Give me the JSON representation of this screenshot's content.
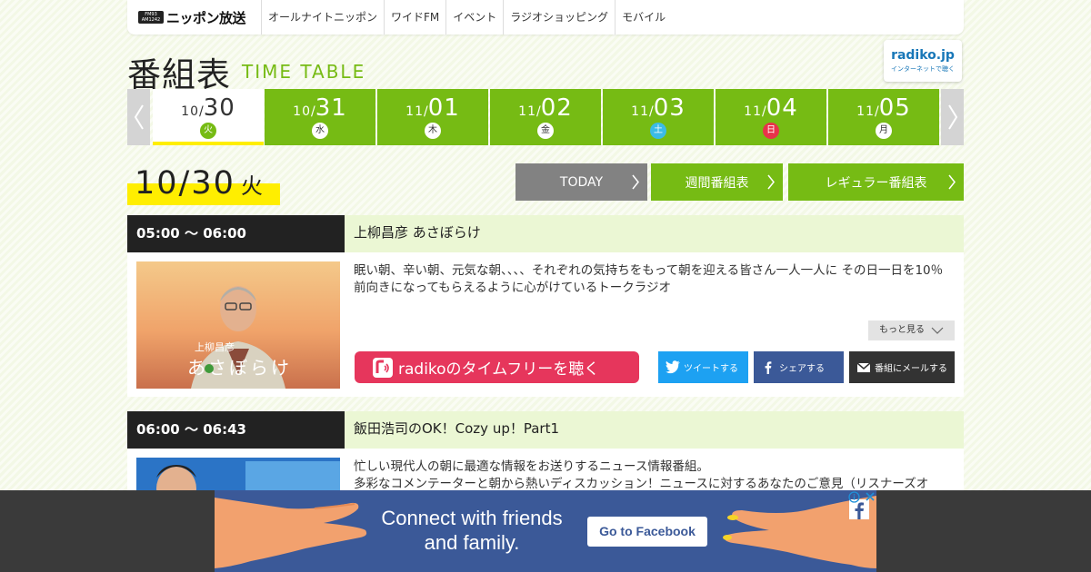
{
  "nav": {
    "logo_badge_top": "FM93",
    "logo_badge_bottom": "AM1242",
    "logo_text": "ニッポン放送",
    "items": [
      "オールナイトニッポン",
      "ワイドFM",
      "イベント",
      "ラジオショッピング",
      "モバイル"
    ]
  },
  "title": {
    "jp": "番組表",
    "en": "TIME TABLE"
  },
  "radiko": {
    "line1": "radiko.jp",
    "line2": "インターネットで聴く"
  },
  "dates": [
    {
      "month": "10",
      "day": "30",
      "dow": "火",
      "active": true
    },
    {
      "month": "10",
      "day": "31",
      "dow": "水"
    },
    {
      "month": "11",
      "day": "01",
      "dow": "木"
    },
    {
      "month": "11",
      "day": "02",
      "dow": "金"
    },
    {
      "month": "11",
      "day": "03",
      "dow": "土"
    },
    {
      "month": "11",
      "day": "04",
      "dow": "日"
    },
    {
      "month": "11",
      "day": "05",
      "dow": "月"
    }
  ],
  "current": {
    "date": "10/30",
    "dow": "火"
  },
  "buttons": {
    "today": "TODAY",
    "weekly": "週間番組表",
    "regular": "レギュラー番組表"
  },
  "programs": [
    {
      "time": "05:00 ～ 06:00",
      "title": "上柳昌彦 あさぼらけ",
      "desc": "眠い朝、辛い朝、元気な朝、、、、それぞれの気持ちをもって朝を迎える皆さん一人一人に その日一日を10％前向きになってもらえるように心がけているトークラジオ",
      "img_caption_small": "上柳昌彦",
      "img_caption_large": "あさぼらけ",
      "more": "もっと見る",
      "radiko": "radikoのタイムフリーを聴く",
      "tweet": "ツイートする",
      "share": "シェアする",
      "mail": "番組にメールする"
    },
    {
      "time": "06:00 ～ 06:43",
      "title": "飯田浩司のOK！Cozy up！Part1",
      "desc_lines": [
        "忙しい現代人の朝に最適な情報をお送りするニュース情報番組。",
        "多彩なコメンテーターと朝から熱いディスカッション！ニュースに対するあなたのご意見（リスナーズオ"
      ]
    }
  ],
  "ad": {
    "line1": "Connect with friends",
    "line2": "and family.",
    "button": "Go to Facebook",
    "brand_color": "#3b5998"
  },
  "colors": {
    "accent": "#76bb14",
    "highlight": "#ffee00",
    "radiko_pink": "#e6365c",
    "twitter": "#1da1f2",
    "facebook": "#3b5998"
  }
}
